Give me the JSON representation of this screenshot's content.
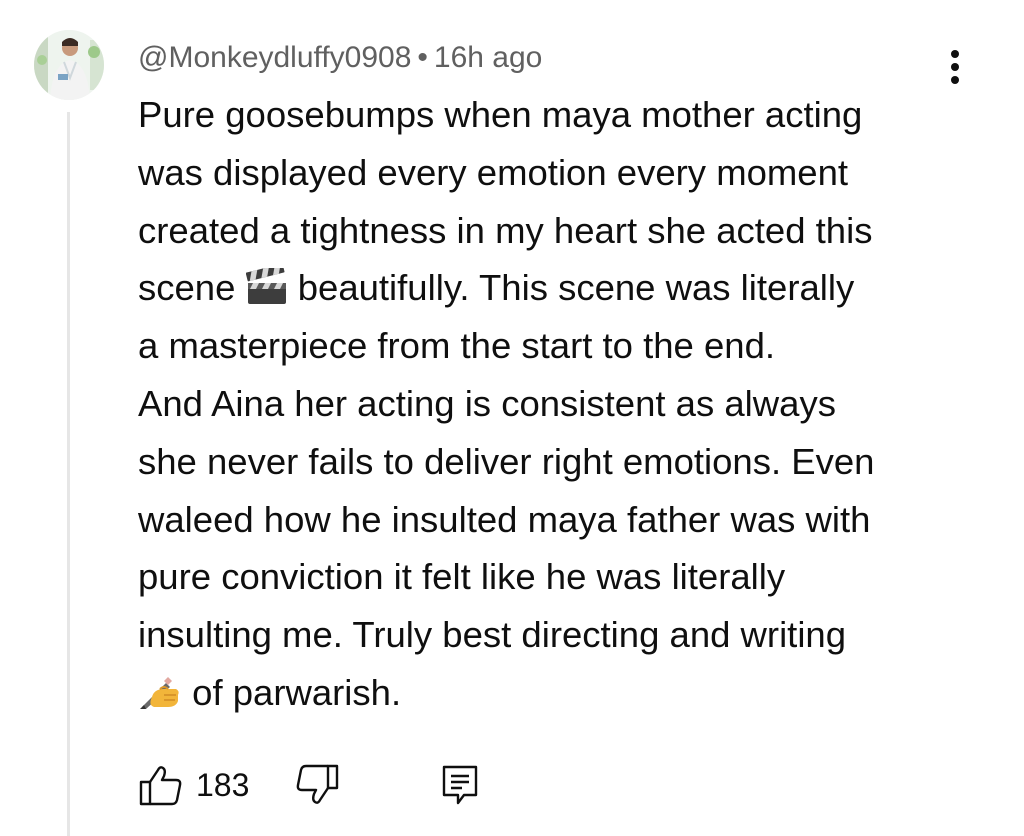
{
  "comment": {
    "author": "@Monkeydluffy0908",
    "separator": "•",
    "time": "16h ago",
    "lines": [
      "Pure goosebumps when maya mother acting",
      "was displayed every emotion every moment",
      "created a tightness in my heart she acted this",
      "scene",
      "beautifully. This scene was literally",
      "a masterpiece from the start to the end.",
      "And Aina her acting is consistent as always",
      "she never fails to deliver right emotions. Even",
      "waleed how he insulted maya father was with",
      "pure conviction it felt like he was literally",
      "insulting me. Truly best directing and writing",
      "of parwarish."
    ],
    "emoji": {
      "clapper": "clapper-board-emoji",
      "writing_hand": "writing-hand-emoji"
    },
    "like_count": "183"
  },
  "icons": {
    "menu": "more-vertical-icon",
    "like": "thumbs-up-icon",
    "dislike": "thumbs-down-icon",
    "reply": "comment-reply-icon"
  },
  "colors": {
    "text": "#0f0f0f",
    "meta": "#606060",
    "thread_line": "#e6e6e6"
  }
}
